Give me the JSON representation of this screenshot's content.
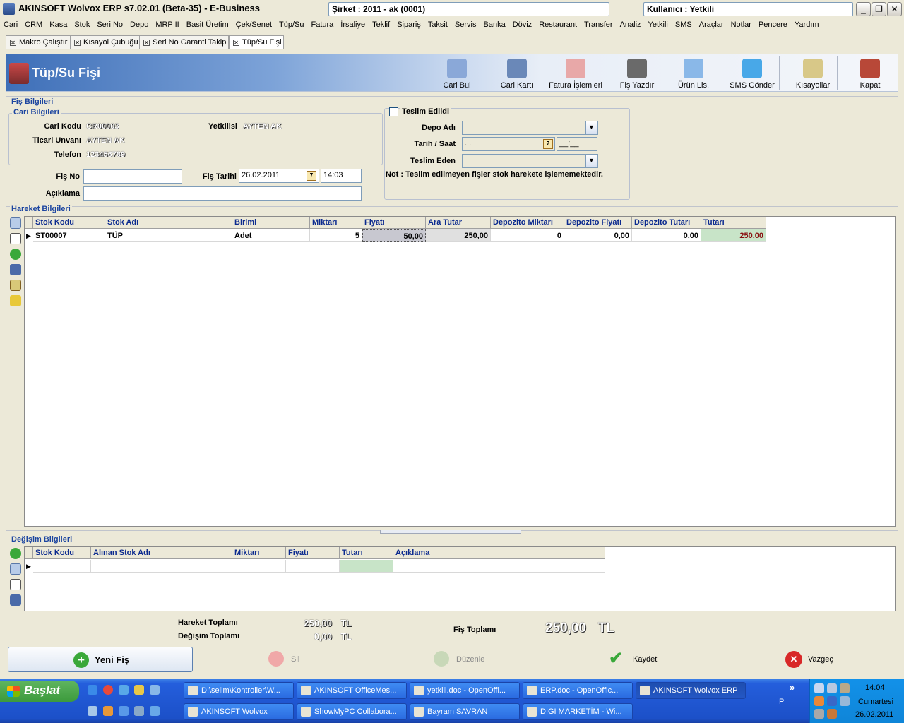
{
  "window": {
    "title": "AKINSOFT Wolvox ERP s7.02.01 (Beta-35) - E-Business",
    "company": "Şirket : 2011 - ak (0001)",
    "user": "Kullanıcı : Yetkili",
    "min": "_",
    "max": "❐",
    "close": "✕"
  },
  "menu": [
    "Cari",
    "CRM",
    "Kasa",
    "Stok",
    "Seri No",
    "Depo",
    "MRP II",
    "Basit Üretim",
    "Çek/Senet",
    "Tüp/Su",
    "Fatura",
    "İrsaliye",
    "Teklif",
    "Sipariş",
    "Taksit",
    "Servis",
    "Banka",
    "Döviz",
    "Restaurant",
    "Transfer",
    "Analiz",
    "Yetkili",
    "SMS",
    "Araçlar",
    "Notlar",
    "Pencere",
    "Yardım"
  ],
  "tabs": [
    "Makro Çalıştır",
    "Kısayol Çubuğu",
    "Seri No Garanti Takip",
    "Tüp/Su Fişi"
  ],
  "banner": {
    "title": "Tüp/Su Fişi"
  },
  "toolbar": [
    "Cari Bul",
    "Cari Kartı",
    "Fatura İşlemleri",
    "Fiş Yazdır",
    "Ürün Lis.",
    "SMS Gönder",
    "Kısayollar",
    "Kapat"
  ],
  "fis": {
    "group_title": "Fiş Bilgileri",
    "cari_title": "Cari Bilgileri",
    "cari_kodu_label": "Cari Kodu",
    "cari_kodu": "CR00003",
    "ticari_unvan_label": "Ticari Unvanı",
    "ticari_unvan": "AYTEN AK",
    "telefon_label": "Telefon",
    "telefon": "123456789",
    "yetkili_label": "Yetkilisi",
    "yetkili": "AYTEN AK",
    "fis_no_label": "Fiş No",
    "fis_no": "",
    "fis_tarihi_label": "Fiş Tarihi",
    "fis_tarihi": "26.02.2011",
    "fis_saat": "14:03",
    "aciklama_label": "Açıklama",
    "aciklama": "",
    "teslim_edildi_label": "Teslim Edildi",
    "depo_label": "Depo Adı",
    "tarih_saat_label": "Tarih / Saat",
    "tarih_val": " .  .",
    "saat_val": "__:__",
    "teslim_eden_label": "Teslim Eden",
    "not": "Not : Teslim edilmeyen fişler stok harekete işlememektedir."
  },
  "hareket": {
    "title": "Hareket Bilgileri",
    "columns": [
      "Stok Kodu",
      "Stok Adı",
      "Birimi",
      "Miktarı",
      "Fiyatı",
      "Ara Tutar",
      "Depozito Miktarı",
      "Depozito Fiyatı",
      "Depozito Tutarı",
      "Tutarı"
    ],
    "rows": [
      [
        "ST00007",
        "TÜP",
        "Adet",
        "5",
        "50,00",
        "250,00",
        "0",
        "0,00",
        "0,00",
        "250,00"
      ]
    ]
  },
  "degisim": {
    "title": "Değişim Bilgileri",
    "columns": [
      "Stok Kodu",
      "Alınan Stok Adı",
      "Miktarı",
      "Fiyatı",
      "Tutarı",
      "Açıklama"
    ]
  },
  "totals": {
    "hareket_label": "Hareket Toplamı",
    "hareket_val": "250,00",
    "degisim_label": "Değişim Toplamı",
    "degisim_val": "0,00",
    "currency": "TL",
    "fis_label": "Fiş Toplamı",
    "fis_val": "250,00"
  },
  "actions": {
    "yeni": "Yeni Fiş",
    "sil": "Sil",
    "duzenle": "Düzenle",
    "kaydet": "Kaydet",
    "vazgec": "Vazgeç"
  },
  "taskbar": {
    "start": "Başlat",
    "row1": [
      "D:\\selim\\Kontroller\\W...",
      "AKINSOFT OfficeMes...",
      "yetkili.doc - OpenOffi...",
      "ERP.doc - OpenOffic...",
      "AKINSOFT Wolvox ERP"
    ],
    "row2": [
      "AKINSOFT Wolvox",
      "ShowMyPC Collabora...",
      "Bayram SAVRAN",
      "DIGI MARKETİM - Wi..."
    ],
    "more": "»",
    "p": "P",
    "time": "14:04",
    "day": "Cumartesi",
    "date": "26.02.2011"
  }
}
